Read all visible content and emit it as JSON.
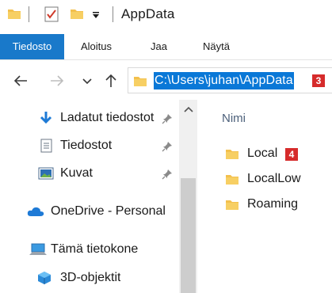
{
  "window": {
    "title": "AppData"
  },
  "ribbon": {
    "tabs": [
      {
        "label": "Tiedosto"
      },
      {
        "label": "Aloitus"
      },
      {
        "label": "Jaa"
      },
      {
        "label": "Näytä"
      }
    ]
  },
  "address": {
    "path": "C:\\Users\\juhan\\AppData",
    "badge": "3"
  },
  "sidebar": {
    "items": [
      {
        "label": "Ladatut tiedostot",
        "icon": "download-arrow-icon",
        "pinned": true
      },
      {
        "label": "Tiedostot",
        "icon": "documents-icon",
        "pinned": true
      },
      {
        "label": "Kuvat",
        "icon": "pictures-icon",
        "pinned": true
      },
      {
        "label": "OneDrive - Personal",
        "icon": "onedrive-cloud-icon",
        "pinned": false
      },
      {
        "label": "Tämä tietokone",
        "icon": "computer-icon",
        "pinned": false
      },
      {
        "label": "3D-objektit",
        "icon": "3d-objects-icon",
        "pinned": false
      }
    ]
  },
  "content": {
    "column_header": "Nimi",
    "files": [
      {
        "name": "Local",
        "icon": "folder-icon",
        "badge": "4"
      },
      {
        "name": "LocalLow",
        "icon": "folder-icon"
      },
      {
        "name": "Roaming",
        "icon": "folder-icon"
      }
    ]
  },
  "colors": {
    "accent": "#1979ca",
    "selection": "#0a78d7",
    "badge": "#d62b2b",
    "folder": "#f3c04d"
  }
}
